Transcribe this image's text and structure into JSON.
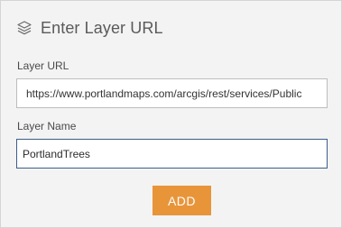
{
  "dialog": {
    "title": "Enter Layer URL",
    "icon": "layers-icon"
  },
  "layer_url": {
    "label": "Layer URL",
    "value": "https://www.portlandmaps.com/arcgis/rest/services/Public"
  },
  "layer_name": {
    "label": "Layer Name",
    "value": "PortlandTrees"
  },
  "actions": {
    "add_label": "ADD"
  },
  "colors": {
    "accent": "#e8953a",
    "panel_bg": "#f3f3f3",
    "focus_border": "#3c5e8a"
  }
}
